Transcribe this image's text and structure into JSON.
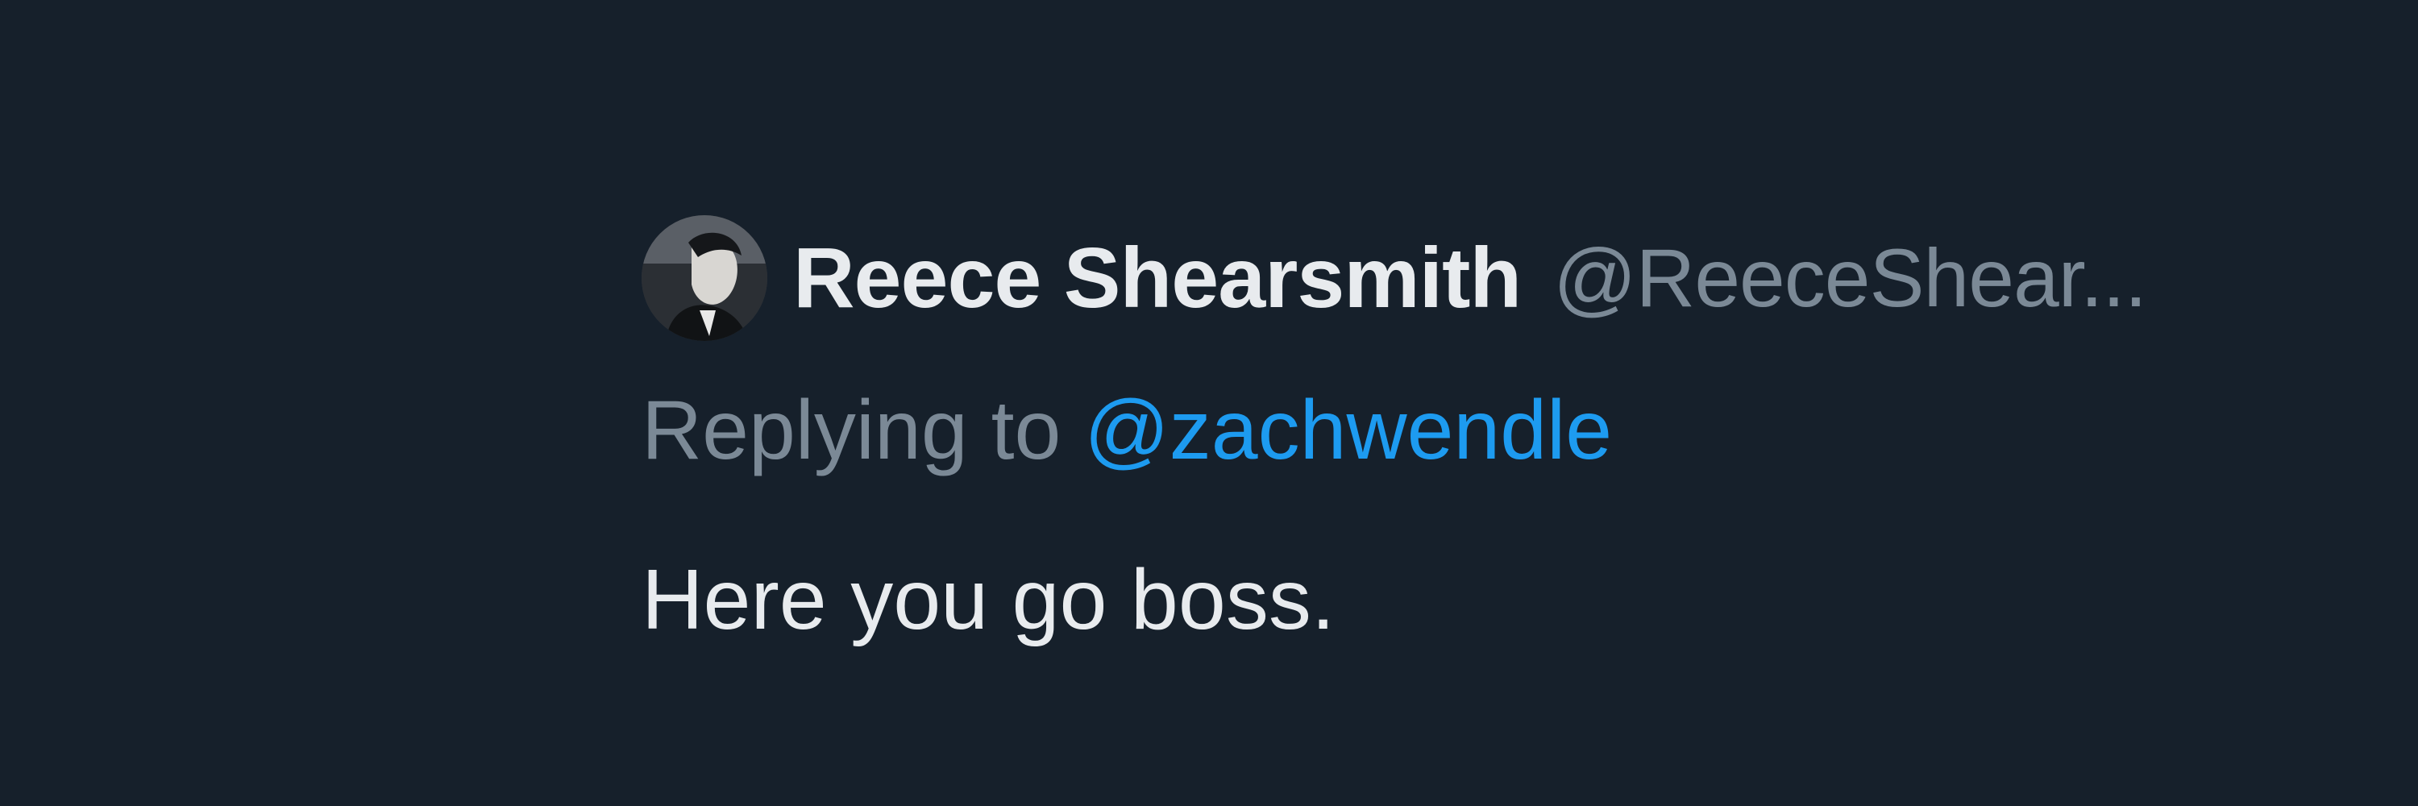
{
  "tweet": {
    "author": {
      "display_name": "Reece Shearsmith",
      "handle": "@ReeceShear...",
      "avatar_icon": "profile-photo"
    },
    "reply": {
      "prefix": "Replying to ",
      "mention": "@zachwendle"
    },
    "text": "Here you go boss."
  },
  "colors": {
    "background": "#16202b",
    "primary_text": "#e8ebee",
    "secondary_text": "#7b8996",
    "link": "#1d9bf0"
  }
}
